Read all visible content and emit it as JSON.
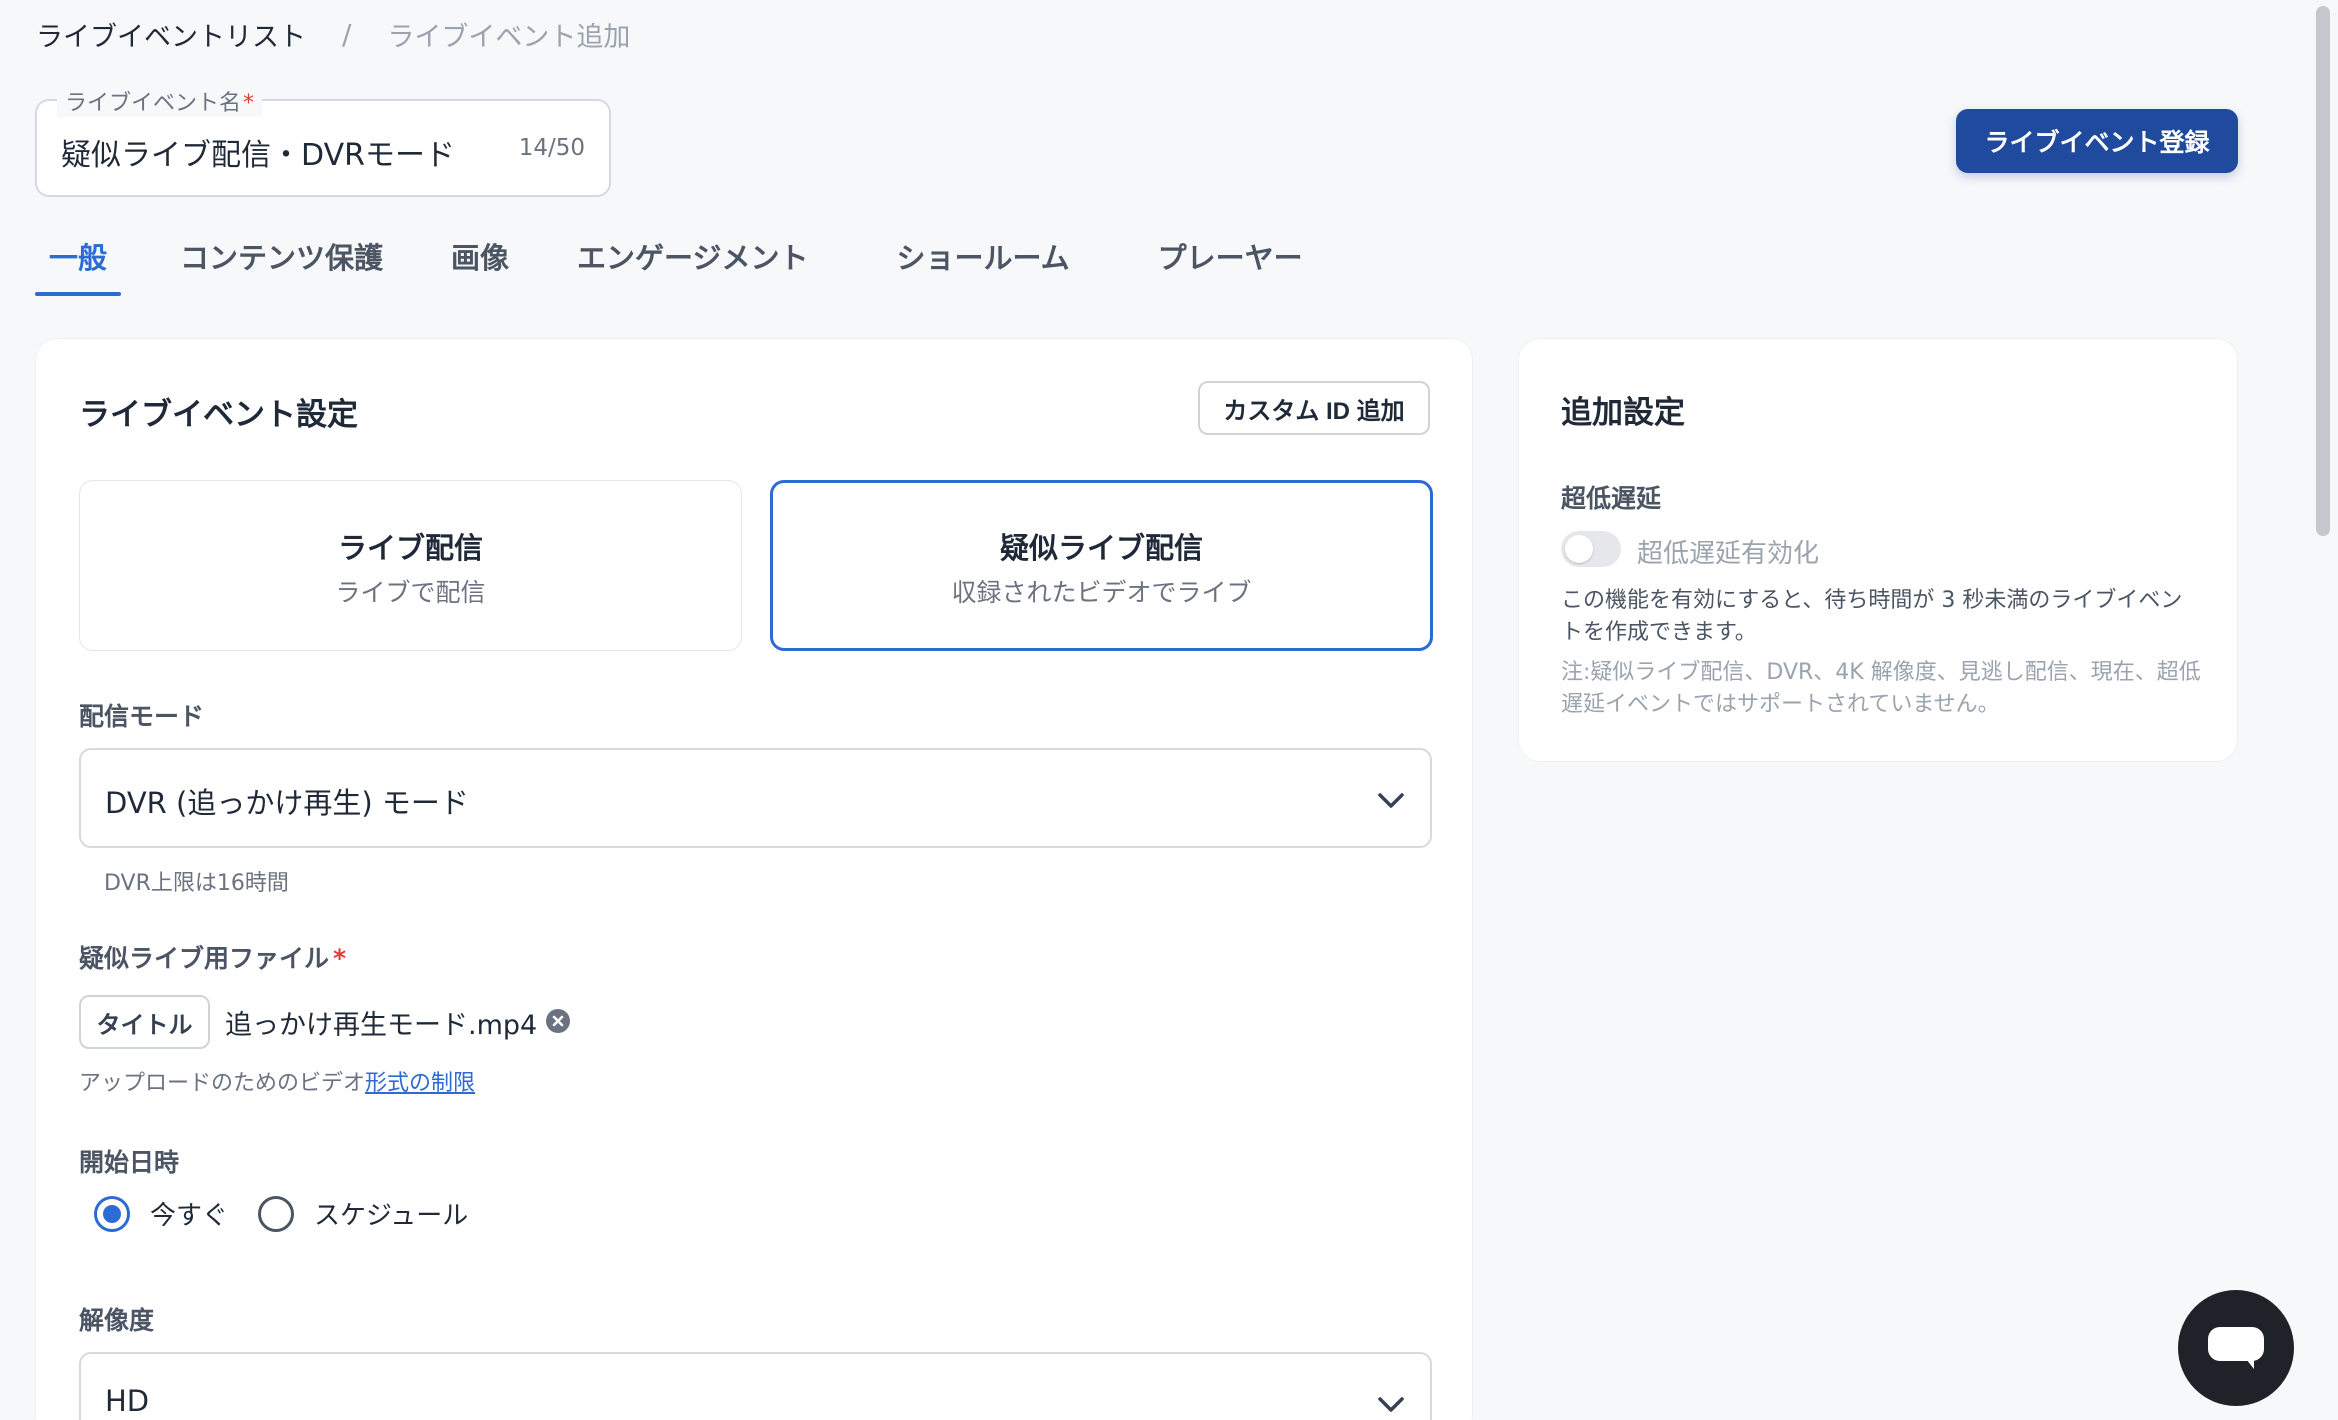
{
  "breadcrumb": {
    "parent": "ライブイベントリスト",
    "separator": "/",
    "current": "ライブイベント追加"
  },
  "name_field": {
    "label": "ライブイベント名",
    "required_mark": "*",
    "value": "疑似ライブ配信・DVRモード",
    "counter": "14/50"
  },
  "register_button": "ライブイベント登録",
  "tabs": [
    {
      "label": "一般",
      "active": true
    },
    {
      "label": "コンテンツ保護",
      "active": false
    },
    {
      "label": "画像",
      "active": false
    },
    {
      "label": "エンゲージメント",
      "active": false
    },
    {
      "label": "ショールーム",
      "active": false
    },
    {
      "label": "プレーヤー",
      "active": false
    }
  ],
  "main": {
    "title": "ライブイベント設定",
    "custom_id_button": "カスタム ID 追加",
    "mode_options": [
      {
        "title": "ライブ配信",
        "subtitle": "ライブで配信",
        "selected": false
      },
      {
        "title": "疑似ライブ配信",
        "subtitle": "収録されたビデオでライブ",
        "selected": true
      }
    ],
    "delivery_mode": {
      "label": "配信モード",
      "value": "DVR (追っかけ再生) モード",
      "helper": "DVR上限は16時間"
    },
    "pseudo_file": {
      "label": "疑似ライブ用ファイル",
      "required_mark": "*",
      "chip": "タイトル",
      "file_name": "追っかけ再生モード.mp4",
      "note_prefix": "アップロードのためのビデオ",
      "note_link": "形式の制限"
    },
    "start_time": {
      "label": "開始日時",
      "options": [
        {
          "label": "今すぐ",
          "checked": true
        },
        {
          "label": "スケジュール",
          "checked": false
        }
      ]
    },
    "resolution": {
      "label": "解像度",
      "value": "HD"
    }
  },
  "side": {
    "title": "追加設定",
    "low_latency_label": "超低遅延",
    "toggle_label": "超低遅延有効化",
    "toggle_on": false,
    "description": "この機能を有効にすると、待ち時間が 3 秒未満のライブイベントを作成できます。",
    "note": "注:疑似ライブ配信、DVR、4K 解像度、見逃し配信、現在、超低遅延イベントではサポートされていません。"
  },
  "colors": {
    "accent": "#2c6ad6",
    "primary_button": "#1f4a9e",
    "required": "#e53935"
  },
  "icons": {
    "select_chevron": "chevron-down-icon",
    "file_remove": "close-circle-icon",
    "chat": "chat-bubble-icon"
  }
}
